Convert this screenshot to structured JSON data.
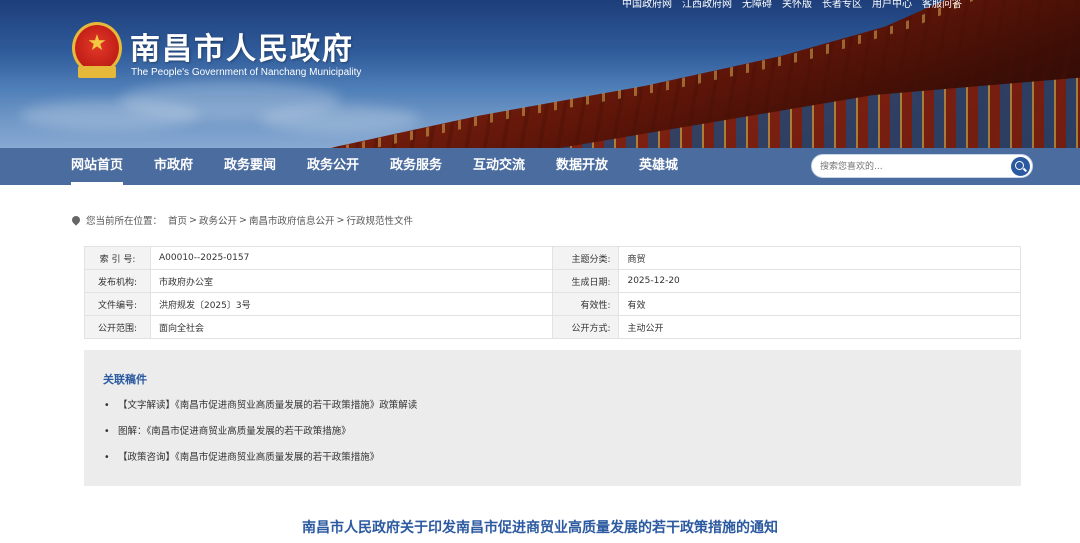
{
  "header": {
    "title": "南昌市人民政府",
    "subtitle": "The People's Government of Nanchang Municipality",
    "top_links": [
      "中国政府网",
      "江西政府网",
      "无障碍",
      "关怀版",
      "长者专区",
      "用户中心",
      "客服问答"
    ]
  },
  "nav": {
    "items": [
      "网站首页",
      "市政府",
      "政务要闻",
      "政务公开",
      "政务服务",
      "互动交流",
      "数据开放",
      "英雄城"
    ],
    "active": "网站首页",
    "search_placeholder": "搜索您喜欢的..."
  },
  "breadcrumb": {
    "label": "您当前所在位置：",
    "items": [
      "首页",
      "政务公开",
      "南昌市政府信息公开",
      "行政规范性文件"
    ],
    "separator": ">"
  },
  "info": {
    "rows": [
      {
        "k1": "索 引 号:",
        "v1": "A00010--2025-0157",
        "k2": "主题分类:",
        "v2": "商贸"
      },
      {
        "k1": "发布机构:",
        "v1": "市政府办公室",
        "k2": "生成日期:",
        "v2": "2025-12-20"
      },
      {
        "k1": "文件编号:",
        "v1": "洪府规发〔2025〕3号",
        "k2": "有效性:",
        "v2": "有效"
      },
      {
        "k1": "公开范围:",
        "v1": "面向全社会",
        "k2": "公开方式:",
        "v2": "主动公开"
      }
    ]
  },
  "related": {
    "title": "关联稿件",
    "bullet": "•",
    "items": [
      "【文字解读】《南昌市促进商贸业高质量发展的若干政策措施》政策解读",
      "图解：《南昌市促进商贸业高质量发展的若干政策措施》",
      "【政策咨询】《南昌市促进商贸业高质量发展的若干政策措施》"
    ]
  },
  "document": {
    "title": "南昌市人民政府关于印发南昌市促进商贸业高质量发展的若干政策措施的通知"
  },
  "colors": {
    "nav_bg": "#3c6096",
    "accent_blue": "#2c5aa0",
    "panel_bg": "#ececec"
  }
}
